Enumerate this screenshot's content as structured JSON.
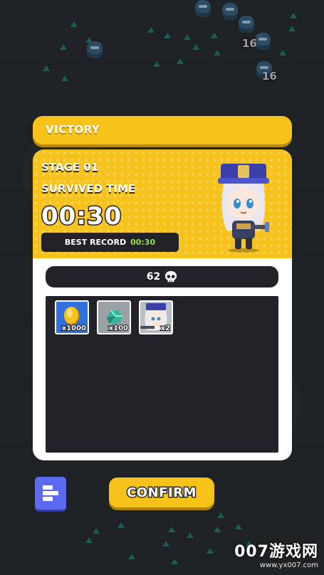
{
  "header": {
    "title": "VICTORY"
  },
  "result": {
    "stage": "STAGE 01",
    "survived_label": "SURVIVED TIME",
    "time": "00:30",
    "best_record_label": "BEST RECORD",
    "best_record_value": "00:30"
  },
  "kills": {
    "count": "62",
    "icon": "skull-icon"
  },
  "rewards": [
    {
      "name": "gold-coin",
      "quantity": "x1000",
      "bg": "#2f6fe0"
    },
    {
      "name": "green-gem",
      "quantity": "x100",
      "bg": "#9aa0a6"
    },
    {
      "name": "hero-shard",
      "quantity": "x2",
      "bg": "#b9bfc6"
    }
  ],
  "buttons": {
    "confirm": "CONFIRM",
    "menu_icon": "list-icon"
  },
  "battlefield": {
    "damage_numbers": [
      "16",
      "16"
    ]
  },
  "watermark": {
    "main": "007游戏网",
    "sub": "www.yx007.com"
  },
  "colors": {
    "accent": "#f7c21a",
    "panel_dark": "#232228",
    "best_value": "#9be34a",
    "menu_button": "#5b6af0"
  }
}
